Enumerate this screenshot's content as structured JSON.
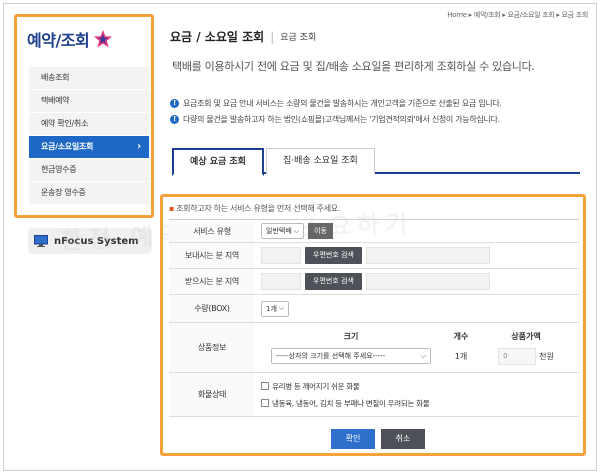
{
  "breadcrumb": "Home ▸ 예약/조회 ▸ 요금/소요일 조회 ▸ 요금 조회",
  "sidebar": {
    "title": "예약/조회",
    "items": [
      {
        "label": "배송조회"
      },
      {
        "label": "택배예약"
      },
      {
        "label": "예약 확인/취소"
      },
      {
        "label": "요금/소요일조회",
        "chevron": "›"
      },
      {
        "label": "현금영수증"
      },
      {
        "label": "운송장 영수증"
      }
    ]
  },
  "nfocus": {
    "label": "nFocus System"
  },
  "watermark": "환전 예약 조회 · 소요하기",
  "header": {
    "title": "요금 / 소요일 조회",
    "separator": "|",
    "subtitle": "요금 조회"
  },
  "intro": "택배를 이용하시기 전에 요금 및 집/배송 소요일을 편리하게 조회하실 수 있습니다.",
  "notes": {
    "icon": "!",
    "items": [
      "요금조회 및 요금 안내 서비스는 소량의 물건을 발송하시는 개인고객을 기준으로 산출된 요금 입니다.",
      "다량의 물건을 발송하고자 하는 법인(쇼핑몰)고객님께서는 '기업견적의뢰'에서 신청이 가능하십니다."
    ]
  },
  "tabs": [
    {
      "label": "예상 요금 조회"
    },
    {
      "label": "집·배송 소요일 조회"
    }
  ],
  "form": {
    "hint_bullet": "▪",
    "hint": "조회하고자 하는 서비스 유형을 먼저 선택해 주세요.",
    "service_type": {
      "label": "서비스 유형",
      "value": "일반택배",
      "button": "이동"
    },
    "sender_area": {
      "label": "보내시는 분 지역",
      "button": "우편번호 검색"
    },
    "receiver_area": {
      "label": "받으시는 분 지역",
      "button": "우편번호 검색"
    },
    "quantity": {
      "label": "수량(BOX)",
      "value": "1개"
    },
    "product": {
      "label": "상품정보",
      "col_size": "크기",
      "col_count": "개수",
      "col_price": "상품가액",
      "size_placeholder": "-----상자의 크기를 선택해 주세요-----",
      "count": "1개",
      "price_value": "0",
      "price_unit": "천원"
    },
    "cargo": {
      "label": "화물상태",
      "options": [
        "유리병 등 깨어지기 쉬운 화물",
        "냉동육, 냉동어, 김치 등 부패나 변질이 우려되는 화물"
      ]
    },
    "confirm": "확인",
    "cancel": "취소"
  },
  "colors": {
    "accent": "#1c68c4",
    "highlight_border": "#f5a23a",
    "title": "#1c3f8e"
  }
}
